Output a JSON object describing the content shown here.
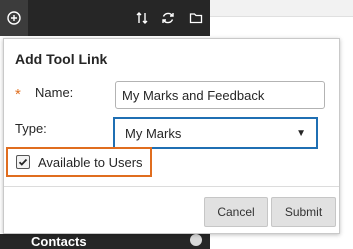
{
  "background": {
    "toolbar": {
      "icons": [
        "plus-icon",
        "sort-icon",
        "refresh-icon",
        "folder-icon"
      ]
    },
    "sidebar": {
      "bottom_item": "Contacts"
    }
  },
  "dialog": {
    "title": "Add Tool Link",
    "required_marker": "*",
    "name_label": "Name:",
    "name_value": "My Marks and Feedback",
    "type_label": "Type:",
    "type_selected": "My Marks",
    "available_label": "Available to Users",
    "available_checked": true,
    "cancel_label": "Cancel",
    "submit_label": "Submit"
  },
  "colors": {
    "accent_focus": "#1f6fb3",
    "highlight": "#e06d1f",
    "required": "#e07020",
    "toolbar": "#262626"
  }
}
